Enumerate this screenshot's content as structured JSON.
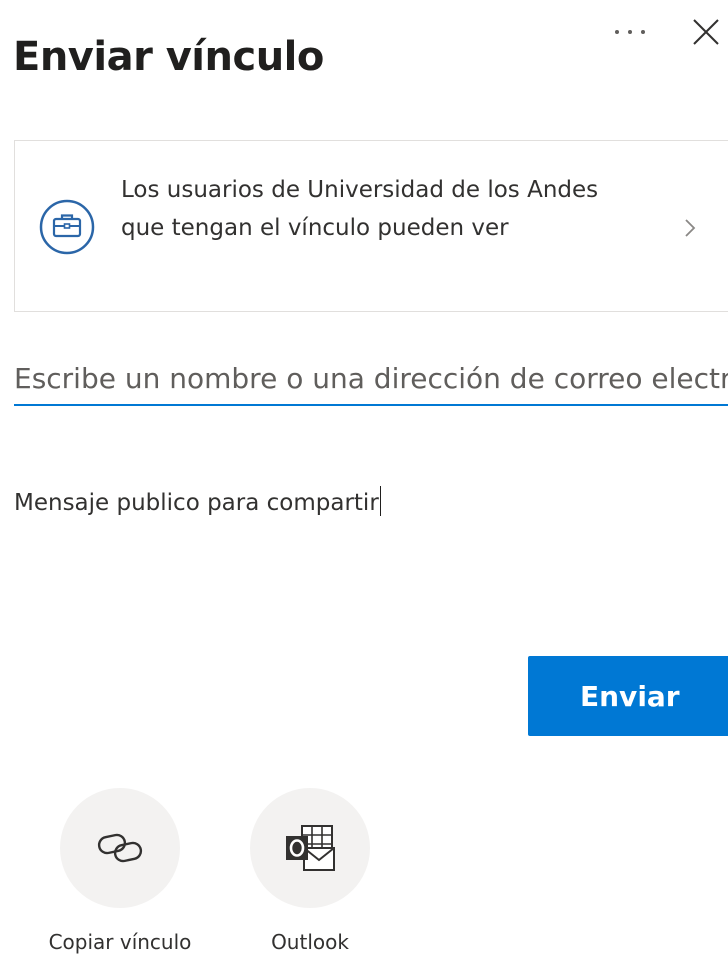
{
  "header": {
    "title": "Enviar vínculo",
    "more_icon": "more-horizontal-icon",
    "close_icon": "close-icon"
  },
  "permission": {
    "text": "Los usuarios de Universidad de los Andes que tengan el vínculo pueden ver",
    "icon": "briefcase-icon",
    "chevron_icon": "chevron-right-icon"
  },
  "recipient": {
    "placeholder": "Escribe un nombre o una dirección de correo electrónico",
    "value": ""
  },
  "message": {
    "value": "Mensaje publico para compartir"
  },
  "send_button": {
    "label": "Enviar"
  },
  "share_options": [
    {
      "label": "Copiar vínculo",
      "icon": "link-icon"
    },
    {
      "label": "Outlook",
      "icon": "outlook-icon"
    }
  ],
  "colors": {
    "accent": "#0078d4",
    "text": "#201f1e",
    "circle_bg": "#f3f2f1",
    "border": "#e1dfdd"
  }
}
